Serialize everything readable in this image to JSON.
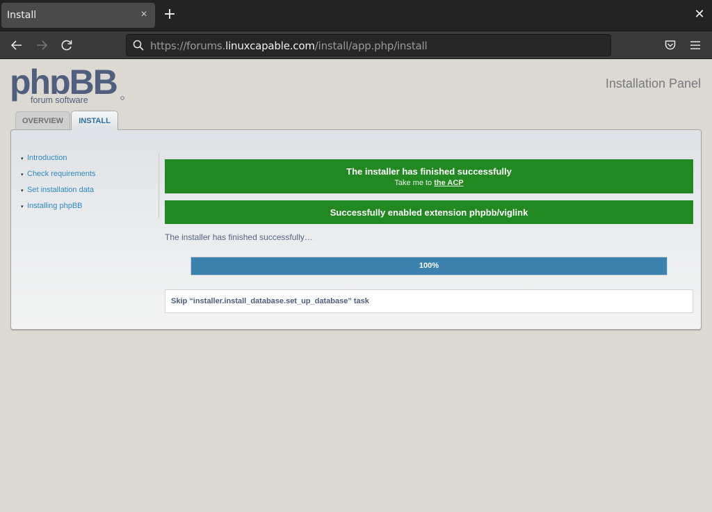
{
  "browser": {
    "tab_title": "Install",
    "tab_close_icon": "×",
    "new_tab_icon": "+",
    "window_close_icon": "✕",
    "url_prefix": "https://forums.",
    "url_host": "linuxcapable.com",
    "url_path": "/install/app.php/install"
  },
  "header": {
    "logo_text": "phpBB",
    "logo_sub": "forum software",
    "panel_title": "Installation Panel"
  },
  "tabs": [
    {
      "label": "OVERVIEW",
      "active": false
    },
    {
      "label": "INSTALL",
      "active": true
    }
  ],
  "sidebar": {
    "items": [
      {
        "label": "Introduction"
      },
      {
        "label": "Check requirements"
      },
      {
        "label": "Set installation data"
      },
      {
        "label": "Installing phpBB"
      }
    ]
  },
  "main": {
    "success_title": "The installer has finished successfully",
    "success_sub_prefix": "Take me to ",
    "success_sub_link": "the ACP",
    "extension_message": "Successfully enabled extension phpbb/viglink",
    "status_text": "The installer has finished successfully…",
    "progress": {
      "percent": 100,
      "label": "100%"
    },
    "log_message": "Skip “installer.install_database.set_up_database” task"
  },
  "colors": {
    "success": "#228822",
    "progress": "#3b83ae",
    "link": "#2c8ac2"
  }
}
